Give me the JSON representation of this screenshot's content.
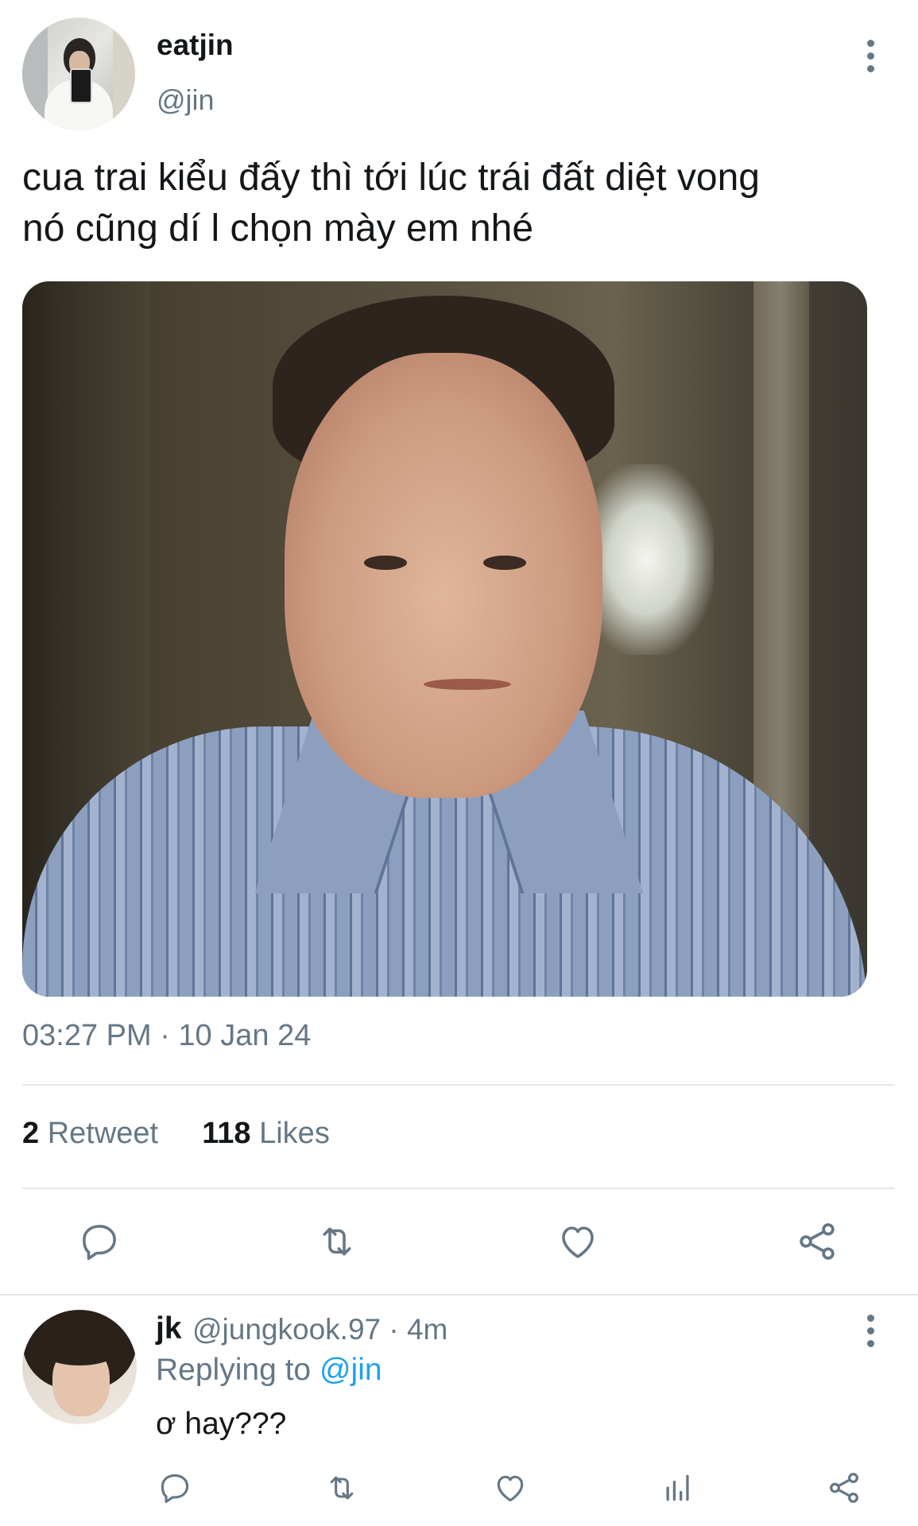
{
  "tweet": {
    "author_name": "eatjin",
    "author_handle": "@jin",
    "text_line1": "cua trai kiểu đấy thì tới lúc trái đất diệt vong",
    "text_line2": "nó cũng dí l chọn mày em nhé",
    "timestamp": "03:27 PM · 10 Jan 24",
    "retweet_count": "2",
    "retweet_label": "Retweet",
    "like_count": "118",
    "like_label": "Likes",
    "actions": [
      "reply-icon",
      "retweet-icon",
      "heart-icon",
      "share-icon"
    ]
  },
  "reply": {
    "author_name": "jk",
    "meta": "@jungkook.97 · 4m",
    "replying_prefix": "Replying to",
    "replying_mention": "@jin",
    "text": "ơ hay???",
    "actions": [
      "reply-icon",
      "retweet-icon",
      "heart-icon",
      "analytics-icon",
      "share-icon"
    ]
  },
  "colors": {
    "text_primary": "#14171a",
    "text_secondary": "#657786",
    "accent": "#1da1f2",
    "divider": "#e1e8ed"
  }
}
